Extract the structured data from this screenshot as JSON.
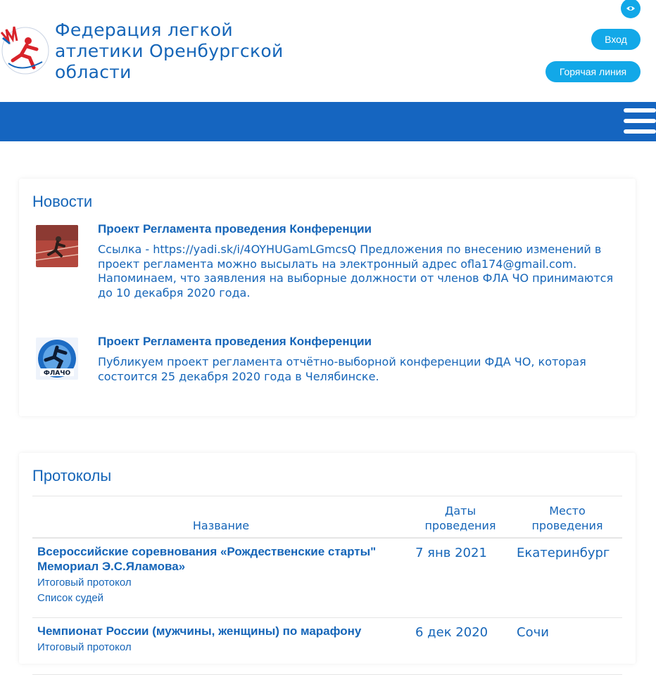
{
  "header": {
    "title": "Федерация легкой атлетики Оренбургской области",
    "login_label": "Вход",
    "hotline_label": "Горячая линия",
    "accent_color": "#12a8e8",
    "nav_color": "#1565c0"
  },
  "news": {
    "title": "Новости",
    "items": [
      {
        "headline": "Проект Регламента проведения Конференции",
        "text": "Ссылка - https://yadi.sk/i/4OYHUGamLGmcsQ Предложения по внесению изменений в проект регламента можно высылать на электронный адрес ofla174@gmail.com. Напоминаем, что заявления на выборные должности от членов ФЛА ЧО принимаются до 10 декабря 2020 года."
      },
      {
        "headline": "Проект Регламента проведения Конференции",
        "text": "Публикуем проект регламента отчётно-выборной конференции ФДА ЧО, которая состоится 25 декабря 2020 года в Челябинске."
      }
    ]
  },
  "protocols": {
    "title": "Протоколы",
    "columns": {
      "name": "Название",
      "dates": "Даты проведения",
      "place": "Место проведения"
    },
    "rows": [
      {
        "name": "Всероссийские соревнования «Рождественские старты\" Мемориал Э.С.Яламова»",
        "links": [
          "Итоговый протокол",
          "Список судей"
        ],
        "date": "7 янв 2021",
        "place": "Екатеринбург"
      },
      {
        "name": "Чемпионат России (мужчины, женщины) по марафону",
        "links": [
          "Итоговый протокол"
        ],
        "date": "6 дек 2020",
        "place": "Сочи"
      }
    ]
  }
}
